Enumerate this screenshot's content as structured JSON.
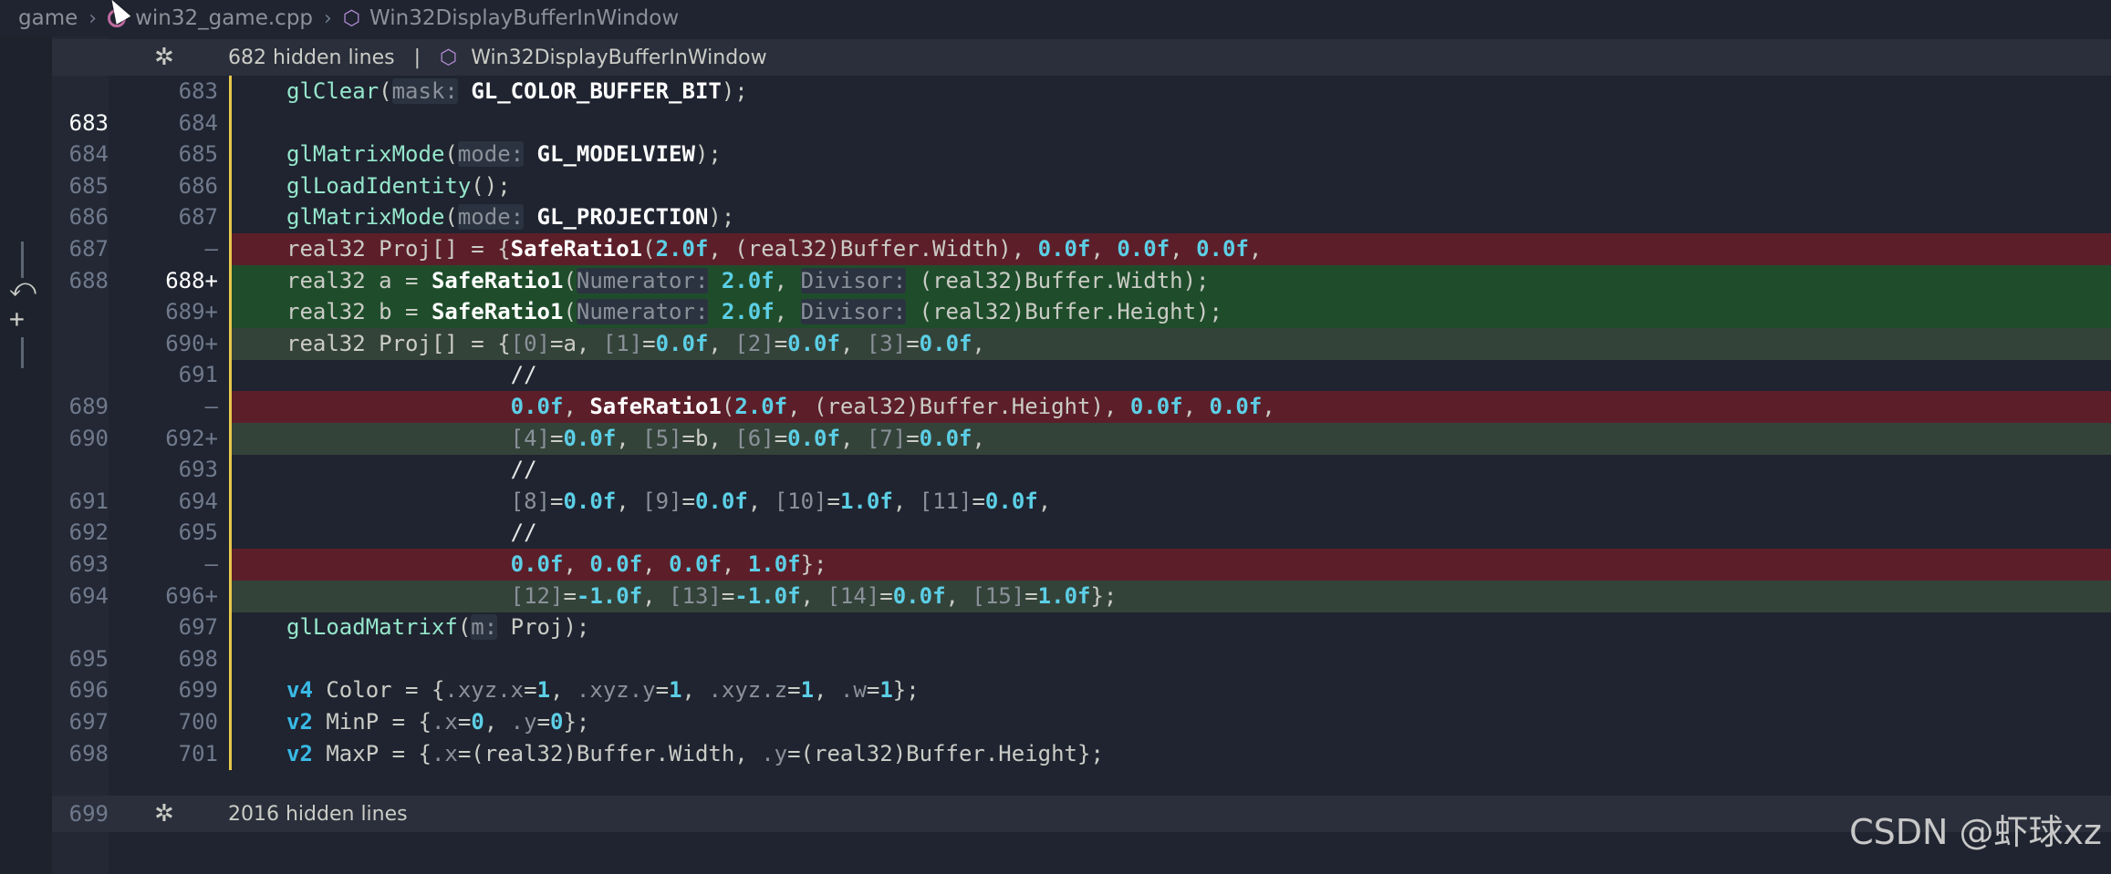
{
  "breadcrumb": {
    "folder": "game",
    "file": "win32_game.cpp",
    "symbol": "Win32DisplayBufferInWindow"
  },
  "fold_top": {
    "hidden": "682 hidden lines",
    "sep": "|",
    "symbol": "Win32DisplayBufferInWindow"
  },
  "fold_bottom": {
    "hidden": "2016 hidden lines"
  },
  "watermark": "CSDN @虾球xz",
  "lines": [
    {
      "old": "",
      "new": "683",
      "kind": "ctx",
      "code": "glClear(mask: GL_COLOR_BUFFER_BIT);"
    },
    {
      "old": "683",
      "new": "684",
      "kind": "ctx",
      "code": ""
    },
    {
      "old": "684",
      "new": "685",
      "kind": "ctx",
      "code": "glMatrixMode(mode: GL_MODELVIEW);"
    },
    {
      "old": "685",
      "new": "686",
      "kind": "ctx",
      "code": "glLoadIdentity();"
    },
    {
      "old": "686",
      "new": "687",
      "kind": "ctx",
      "code": "glMatrixMode(mode: GL_PROJECTION);"
    },
    {
      "old": "687",
      "new": "—",
      "kind": "del",
      "code": "real32 Proj[] = {SafeRatio1(2.0f, (real32)Buffer.Width), 0.0f, 0.0f, 0.0f,"
    },
    {
      "old": "688",
      "new": "688+",
      "kind": "add",
      "code": "real32 a = SafeRatio1(Numerator: 2.0f, Divisor: (real32)Buffer.Width);"
    },
    {
      "old": "",
      "new": "689+",
      "kind": "add",
      "code": "real32 b = SafeRatio1(Numerator: 2.0f, Divisor: (real32)Buffer.Height);"
    },
    {
      "old": "",
      "new": "690+",
      "kind": "mod",
      "code": "real32 Proj[] = {[0]=a, [1]=0.0f, [2]=0.0f, [3]=0.0f,"
    },
    {
      "old": "",
      "new": "691",
      "kind": "ctx",
      "code": "                 //"
    },
    {
      "old": "689",
      "new": "—",
      "kind": "del",
      "code": "                 0.0f, SafeRatio1(2.0f, (real32)Buffer.Height), 0.0f, 0.0f,"
    },
    {
      "old": "690",
      "new": "692+",
      "kind": "mod",
      "code": "                 [4]=0.0f, [5]=b, [6]=0.0f, [7]=0.0f,"
    },
    {
      "old": "",
      "new": "693",
      "kind": "ctx",
      "code": "                 //"
    },
    {
      "old": "691",
      "new": "694",
      "kind": "ctx",
      "code": "                 [8]=0.0f, [9]=0.0f, [10]=1.0f, [11]=0.0f,"
    },
    {
      "old": "692",
      "new": "695",
      "kind": "ctx",
      "code": "                 //"
    },
    {
      "old": "693",
      "new": "—",
      "kind": "del",
      "code": "                 0.0f, 0.0f, 0.0f, 1.0f};"
    },
    {
      "old": "694",
      "new": "696+",
      "kind": "mod",
      "code": "                 [12]=-1.0f, [13]=-1.0f, [14]=0.0f, [15]=1.0f};"
    },
    {
      "old": "",
      "new": "697",
      "kind": "ctx",
      "code": "glLoadMatrixf(m: Proj);"
    },
    {
      "old": "695",
      "new": "698",
      "kind": "ctx",
      "code": ""
    },
    {
      "old": "696",
      "new": "699",
      "kind": "ctx",
      "code": "v4 Color = {.xyz.x=1, .xyz.y=1, .xyz.z=1, .w=1};"
    },
    {
      "old": "697",
      "new": "700",
      "kind": "ctx",
      "code": "v2 MinP = {.x=0, .y=0};"
    },
    {
      "old": "698",
      "new": "701",
      "kind": "ctx",
      "code": "v2 MaxP = {.x=(real32)Buffer.Width, .y=(real32)Buffer.Height};"
    }
  ],
  "bottom_old": "699",
  "colors": {
    "bg": "#1f2430",
    "deleted": "#5c1f29",
    "added": "#1f4d2b",
    "modified": "#34433a",
    "accent": "#e6c84a"
  }
}
